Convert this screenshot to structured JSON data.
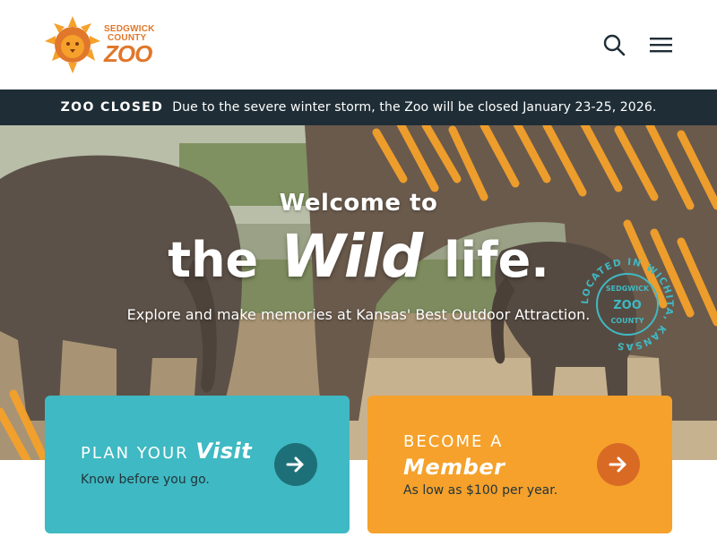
{
  "header": {
    "logo": {
      "line1": "SEDGWICK",
      "line2": "COUNTY",
      "line3": "ZOO"
    },
    "search_icon": "search-icon",
    "menu_icon": "hamburger-menu-icon"
  },
  "alert": {
    "label": "ZOO CLOSED",
    "message": "Due to the severe winter storm, the Zoo will be closed January 23-25, 2026."
  },
  "hero": {
    "title_line1": "Welcome to",
    "title_pre": "the",
    "title_emphasis": "Wild",
    "title_post": "life.",
    "subtitle": "Explore and make memories at Kansas' Best Outdoor Attraction.",
    "badge": {
      "outer_text": "LOCATED IN WICHITA, KANSAS",
      "line1": "SEDGWICK",
      "line2": "ZOO",
      "line3": "COUNTY"
    }
  },
  "cards": {
    "visit": {
      "title_pre": "PLAN YOUR",
      "title_emphasis": "Visit",
      "subtitle": "Know before you go.",
      "icon": "arrow-right-icon"
    },
    "member": {
      "title_pre": "BECOME A",
      "title_emphasis": "Member",
      "subtitle": "As low as $100 per year.",
      "icon": "arrow-right-icon"
    }
  },
  "colors": {
    "brand_orange": "#e0772a",
    "alert_bg": "#1f2e36",
    "visit_card": "#3fb9c3",
    "member_card": "#f5a12b",
    "badge_teal": "#3fb9c3"
  }
}
